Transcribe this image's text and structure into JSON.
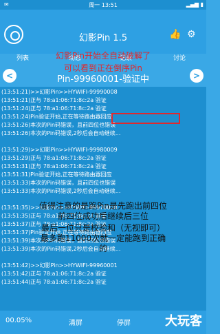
{
  "status": {
    "time": "周一 13:51"
  },
  "header": {
    "title": "幻影Pin 1.5",
    "tabs": [
      "列表",
      "动态",
      "记录",
      "讨论"
    ]
  },
  "banner": {
    "line1": "幻影Pin开始全自动破解了",
    "line2": "可以看到正在倒序Pin"
  },
  "nav": {
    "prev": "<",
    "next": ">"
  },
  "pin_title": "Pin-99960001-验证中",
  "log_lines": [
    "(13:51:21)>>幻影Pin>>HYWIFI-99990008",
    "(13:51:21)正与 78:a1:06:71:8c:2a 验证",
    "(13:51:24)正与 78:a1:06:71:8c:2a 验证",
    "(13:51:24)Pin验证开始,正在等待路由器回应",
    "(13:51:26)本次的Pin码错误，且前四位也错误",
    "(13:51:26)本次的Pin码错误,2秒后会自动继续...",
    "(13:51:29)>>幻影Pin>>HYWIFI-99980009",
    "(13:51:29)正与 78:a1:06:71:8c:2a 验证",
    "(13:51:31)正与 78:a1:06:71:8c:2a 验证",
    "(13:51:31)Pin验证开始,正在等待路由器回应",
    "(13:51:33)本次的Pin码错误，且前四位也错误",
    "(13:51:33)本次的Pin码错误,2秒后会自动继续...",
    "(13:51:35)>>幻影Pin>>HYWIFI-99970008",
    "(13:51:35)正与 78:a1:06:71:8c:2a 验证",
    "(13:51:37)正与 78:a1:06:71:8c:2a 验证",
    "(13:51:37)Pin验证开始,正在等待路由器回应",
    "(13:51:39)本次的Pin码错误，且前四位也错误",
    "(13:51:39)本次的Pin码错误,2秒后会自动继续...",
    "(13:51:42)>>幻影Pin>>HYWIFI-99960001",
    "(13:51:42)正与 78:a1:06:71:8c:2a 验证",
    "(13:51:44)正与 78:a1:06:71:8c:2a 验证"
  ],
  "highlight": "且前四位也错误",
  "overlay": {
    "l1": "值得注意的是跑Pin是先跑出前四位",
    "l2": "前四位成功后继续后三位",
    "l3": "最后一位只是校验和（无视即可）",
    "l4": "最多跑11000次就一定能跑到正确",
    "l5": "的"
  },
  "bottom": {
    "percent": "00.05%",
    "clear": "清屏",
    "stop": "停屏"
  },
  "watermark": "大玩客"
}
